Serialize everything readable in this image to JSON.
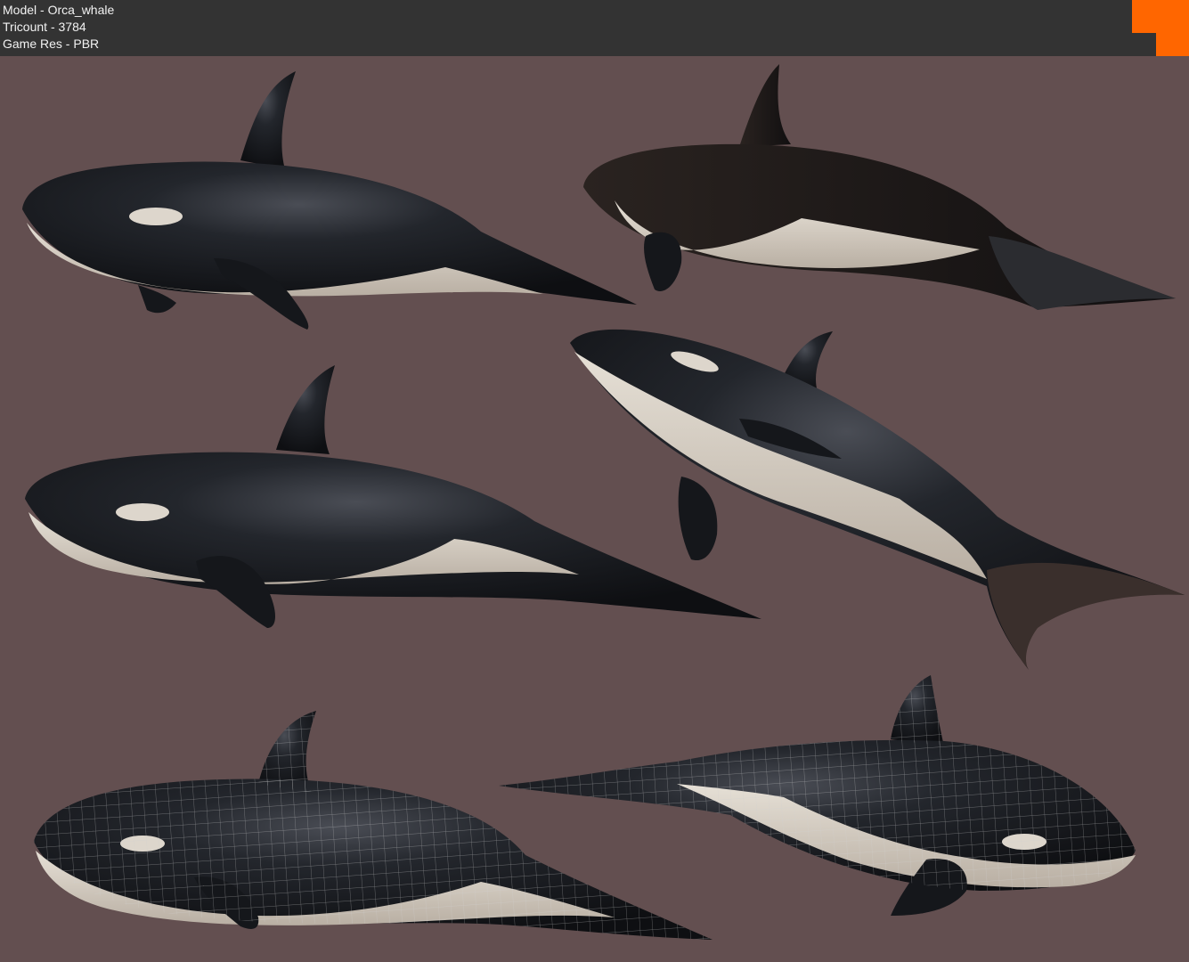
{
  "header": {
    "model": "Model - Orca_whale",
    "tricount": "Tricount - 3784",
    "game_res": "Game Res - PBR"
  },
  "colors": {
    "background": "#634f50",
    "header_bg": "#333333",
    "header_text": "#f2f2f2",
    "logo_accent": "#ff6600",
    "orca_black": "#1b1d22",
    "orca_white": "#d8d0c6"
  },
  "views": [
    {
      "label": "orca-render",
      "wireframe": false
    },
    {
      "label": "orca-render",
      "wireframe": false
    },
    {
      "label": "orca-render",
      "wireframe": false
    },
    {
      "label": "orca-render",
      "wireframe": false
    },
    {
      "label": "orca-wireframe",
      "wireframe": true
    },
    {
      "label": "orca-wireframe",
      "wireframe": true
    }
  ]
}
